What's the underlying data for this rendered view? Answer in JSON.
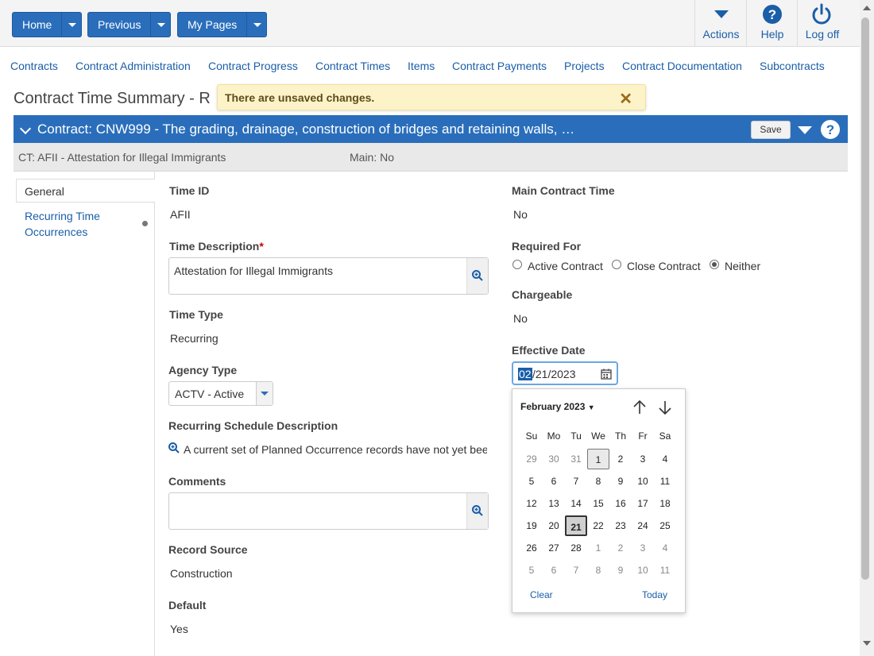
{
  "toolbar": {
    "home_label": "Home",
    "previous_label": "Previous",
    "mypages_label": "My Pages",
    "actions_label": "Actions",
    "help_label": "Help",
    "logoff_label": "Log off"
  },
  "nav": {
    "links": [
      "Contracts",
      "Contract Administration",
      "Contract Progress",
      "Contract Times",
      "Items",
      "Contract Payments",
      "Projects",
      "Contract Documentation",
      "Subcontracts"
    ]
  },
  "page": {
    "title": "Contract Time Summary - R",
    "toast": "There are unsaved changes.",
    "contract_header": "Contract: CNW999 - The grading, drainage, construction of bridges and retaining walls, …",
    "save_label": "Save",
    "ct_line": "CT: AFII - Attestation for Illegal Immigrants",
    "main_line": "Main: No"
  },
  "sidebar": {
    "tab_general": "General",
    "tab_recurring": "Recurring Time Occurrences"
  },
  "form": {
    "time_id_label": "Time ID",
    "time_id_value": "AFII",
    "time_desc_label": "Time Description",
    "required_mark": "*",
    "time_desc_value": "Attestation for Illegal Immigrants",
    "time_type_label": "Time Type",
    "time_type_value": "Recurring",
    "agency_type_label": "Agency Type",
    "agency_type_value": "ACTV - Active",
    "recurring_desc_label": "Recurring Schedule Description",
    "recurring_desc_value": "A current set of Planned Occurrence records have not yet bee",
    "comments_label": "Comments",
    "comments_value": "",
    "record_source_label": "Record Source",
    "record_source_value": "Construction",
    "default_label": "Default",
    "default_value": "Yes",
    "main_contract_time_label": "Main Contract Time",
    "main_contract_time_value": "No",
    "required_for_label": "Required For",
    "required_for_options": [
      "Active Contract",
      "Close Contract",
      "Neither"
    ],
    "required_for_selected": "Neither",
    "chargeable_label": "Chargeable",
    "chargeable_value": "No",
    "effective_date_label": "Effective Date",
    "effective_date_month_part": "02",
    "effective_date_rest": "/21/2023"
  },
  "calendar": {
    "month_label": "February 2023",
    "weekdays": [
      "Su",
      "Mo",
      "Tu",
      "We",
      "Th",
      "Fr",
      "Sa"
    ],
    "weeks": [
      [
        "29",
        "30",
        "31",
        "1",
        "2",
        "3",
        "4"
      ],
      [
        "5",
        "6",
        "7",
        "8",
        "9",
        "10",
        "11"
      ],
      [
        "12",
        "13",
        "14",
        "15",
        "16",
        "17",
        "18"
      ],
      [
        "19",
        "20",
        "21",
        "22",
        "23",
        "24",
        "25"
      ],
      [
        "26",
        "27",
        "28",
        "1",
        "2",
        "3",
        "4"
      ],
      [
        "5",
        "6",
        "7",
        "8",
        "9",
        "10",
        "11"
      ]
    ],
    "today_day": "1",
    "selected_day": "21",
    "clear_label": "Clear",
    "today_label": "Today"
  }
}
